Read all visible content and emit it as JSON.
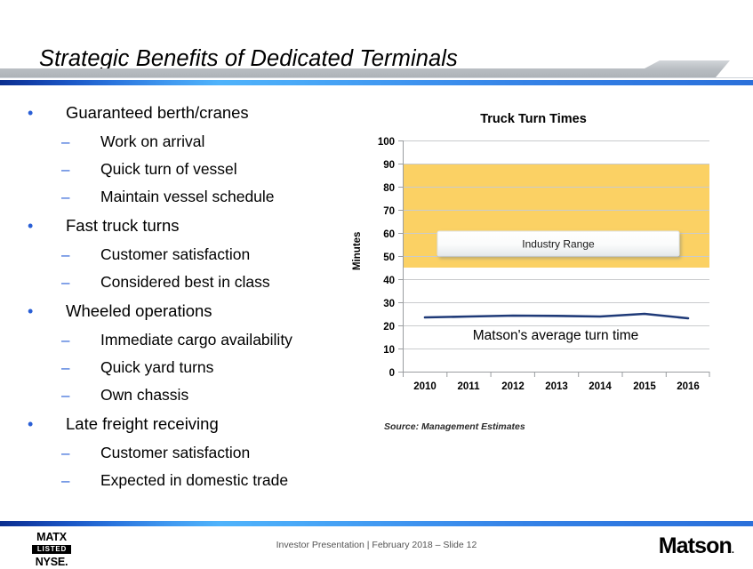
{
  "header": {
    "title": "Strategic Benefits of Dedicated Terminals",
    "accent_color": "#2a74dd",
    "swoosh_color": "#b9bdc2"
  },
  "content": {
    "bullets": [
      {
        "level": 1,
        "marker": "•",
        "text": "Guaranteed berth/cranes"
      },
      {
        "level": 2,
        "marker": "–",
        "text": "Work on arrival"
      },
      {
        "level": 2,
        "marker": "–",
        "text": "Quick turn of vessel"
      },
      {
        "level": 2,
        "marker": "–",
        "text": "Maintain vessel schedule"
      },
      {
        "level": 1,
        "marker": "•",
        "text": "Fast truck turns"
      },
      {
        "level": 2,
        "marker": "–",
        "text": "Customer satisfaction"
      },
      {
        "level": 2,
        "marker": "–",
        "text": "Considered best in class"
      },
      {
        "level": 1,
        "marker": "•",
        "text": "Wheeled operations"
      },
      {
        "level": 2,
        "marker": "–",
        "text": "Immediate cargo availability"
      },
      {
        "level": 2,
        "marker": "–",
        "text": "Quick yard turns"
      },
      {
        "level": 2,
        "marker": "–",
        "text": "Own chassis"
      },
      {
        "level": 1,
        "marker": "•",
        "text": "Late freight receiving"
      },
      {
        "level": 2,
        "marker": "–",
        "text": "Customer satisfaction"
      },
      {
        "level": 2,
        "marker": "–",
        "text": "Expected in domestic trade"
      }
    ],
    "source_note": "Source: Management Estimates"
  },
  "chart_data": {
    "type": "line",
    "title": "Truck Turn Times",
    "xlabel": "",
    "ylabel": "Minutes",
    "ylim": [
      0,
      100
    ],
    "ytick_step": 10,
    "yticks": [
      0,
      10,
      20,
      30,
      40,
      50,
      60,
      70,
      80,
      90,
      100
    ],
    "grid": true,
    "legend_position": "none",
    "categories": [
      "2010",
      "2011",
      "2012",
      "2013",
      "2014",
      "2015",
      "2016"
    ],
    "series": [
      {
        "name": "Matson's average turn time",
        "color": "#1f3a78",
        "values": [
          23.5,
          24.0,
          24.4,
          24.3,
          24.0,
          25.0,
          23.0
        ]
      }
    ],
    "bands": [
      {
        "name": "Industry Range",
        "label": "Industry Range",
        "y_from": 45,
        "y_to": 90,
        "color": "#fbd164"
      }
    ],
    "annotations": [
      {
        "name": "series-annotation",
        "text": "Matson’s average turn time"
      }
    ]
  },
  "footer": {
    "badge_top": "MATX",
    "badge_mid": "LISTED",
    "badge_bottom": "NYSE.",
    "caption": "Investor Presentation | February 2018 – Slide 12",
    "logo": "Matson",
    "logo_mark": "."
  }
}
